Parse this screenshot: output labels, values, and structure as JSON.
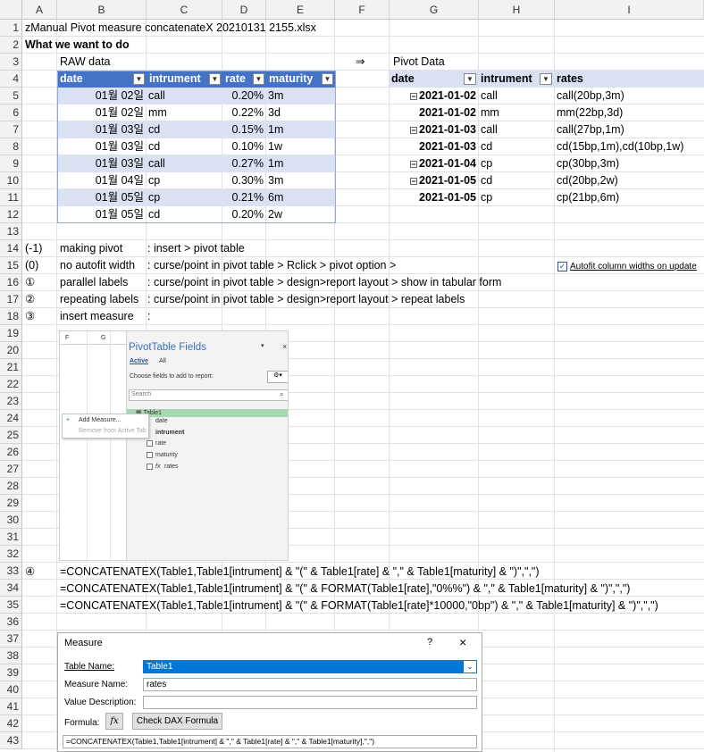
{
  "columns": [
    "A",
    "B",
    "C",
    "D",
    "E",
    "F",
    "G",
    "H",
    "I"
  ],
  "rows": [
    "1",
    "2",
    "3",
    "4",
    "5",
    "6",
    "7",
    "8",
    "9",
    "10",
    "11",
    "12",
    "13",
    "14",
    "15",
    "16",
    "17",
    "18",
    "19",
    "20",
    "21",
    "22",
    "23",
    "24",
    "25",
    "26",
    "27",
    "28",
    "29",
    "30",
    "31",
    "32",
    "33",
    "34",
    "35",
    "36",
    "37",
    "38",
    "39",
    "40",
    "41",
    "42",
    "43"
  ],
  "a1_title": "zManual Pivot measure concatenateX 20210131 2155.xlsx",
  "a2_heading": "What we want to do",
  "raw_label": "RAW data",
  "arrow": "⇒",
  "pivot_label": "Pivot Data",
  "raw_headers": [
    "date",
    "intrument",
    "rate",
    "maturity"
  ],
  "raw_rows": [
    [
      "01월 02일",
      "call",
      "0.20%",
      "3m"
    ],
    [
      "01월 02일",
      "mm",
      "0.22%",
      "3d"
    ],
    [
      "01월 03일",
      "cd",
      "0.15%",
      "1m"
    ],
    [
      "01월 03일",
      "cd",
      "0.10%",
      "1w"
    ],
    [
      "01월 03일",
      "call",
      "0.27%",
      "1m"
    ],
    [
      "01월 04일",
      "cp",
      "0.30%",
      "3m"
    ],
    [
      "01월 05일",
      "cp",
      "0.21%",
      "6m"
    ],
    [
      "01월 05일",
      "cd",
      "0.20%",
      "2w"
    ]
  ],
  "pivot_headers": [
    "date",
    "intrument",
    "rates"
  ],
  "pivot_rows": [
    {
      "date": "2021-01-02",
      "instr": "call",
      "rates": "call(20bp,3m)",
      "collapse": true
    },
    {
      "date": "2021-01-02",
      "instr": "mm",
      "rates": "mm(22bp,3d)",
      "collapse": false
    },
    {
      "date": "2021-01-03",
      "instr": "call",
      "rates": "call(27bp,1m)",
      "collapse": true
    },
    {
      "date": "2021-01-03",
      "instr": "cd",
      "rates": "cd(15bp,1m),cd(10bp,1w)",
      "collapse": false
    },
    {
      "date": "2021-01-04",
      "instr": "cp",
      "rates": "cp(30bp,3m)",
      "collapse": true
    },
    {
      "date": "2021-01-05",
      "instr": "cd",
      "rates": "cd(20bp,2w)",
      "collapse": true
    },
    {
      "date": "2021-01-05",
      "instr": "cp",
      "rates": "cp(21bp,6m)",
      "collapse": false
    }
  ],
  "steps": [
    {
      "num": "(-1)",
      "title": "making pivot",
      "desc": ": insert > pivot table"
    },
    {
      "num": "(0)",
      "title": "no autofit width",
      "desc": ": curse/point in pivot table > Rclick > pivot option >"
    },
    {
      "num": "①",
      "title": "parallel labels",
      "desc": ": curse/point in pivot table > design>report layout > show in tabular form"
    },
    {
      "num": "②",
      "title": "repeating labels",
      "desc": ": curse/point in pivot table > design>report layout > repeat labels"
    },
    {
      "num": "③",
      "title": "insert measure",
      "desc": ":"
    }
  ],
  "autofit_label": "Autofit column widths on update",
  "formula_num": "④",
  "formulas": [
    "=CONCATENATEX(Table1,Table1[intrument] & \"(\" & Table1[rate] & \",\" & Table1[maturity] & \")\",\",\")",
    "=CONCATENATEX(Table1,Table1[intrument] & \"(\" & FORMAT(Table1[rate],\"0%%\") & \",\" & Table1[maturity] & \")\",\",\")",
    "=CONCATENATEX(Table1,Table1[intrument] & \"(\" & FORMAT(Table1[rate]*10000,\"0bp\") & \",\" & Table1[maturity] & \")\",\",\")"
  ],
  "pt_pane": {
    "col_f": "F",
    "col_g": "G",
    "title": "PivotTable Fields",
    "tab_active": "Active",
    "tab_all": "All",
    "choose": "Choose fields to add to report:",
    "search": "Search",
    "table_name": "Table1",
    "fields": [
      "date",
      "intrument",
      "rate",
      "maturity",
      "rates"
    ],
    "ctx_add": "Add Measure...",
    "ctx_remove": "Remove from Active Tab",
    "close": "×"
  },
  "measure_dialog": {
    "title": "Measure",
    "help": "?",
    "close": "×",
    "table_name_label": "Table Name:",
    "table_name_value": "Table1",
    "measure_name_label": "Measure Name:",
    "measure_name_value": "rates",
    "value_desc_label": "Value Description:",
    "formula_label": "Formula:",
    "fx": "fx",
    "check_btn": "Check DAX Formula",
    "formula_value": "=CONCATENATEX(Table1,Table1[intrument] & \",\" & Table1[rate] & \",\" & Table1[maturity],\",\")"
  }
}
